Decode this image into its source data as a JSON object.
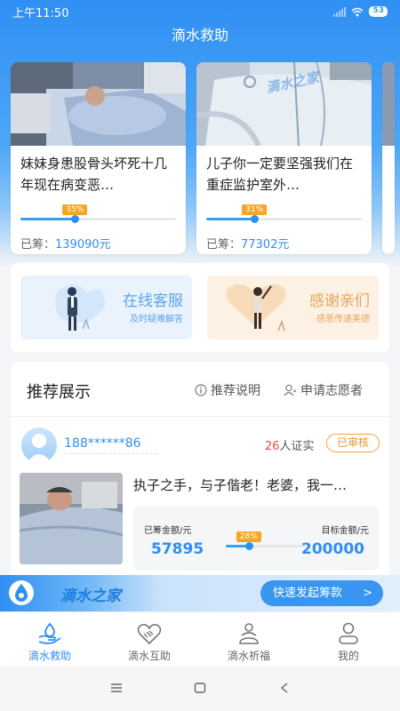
{
  "status_bar": {
    "time": "上午11:50",
    "battery": "53"
  },
  "app": {
    "title": "滴水救助"
  },
  "cases": [
    {
      "title": "妹妹身患股骨头坏死十几年现在病变恶…",
      "progress": 0.35,
      "progress_label": "35%",
      "raised_label": "已筹：",
      "raised_amount": "139090元"
    },
    {
      "title": "儿子你一定要坚强我们在重症监护室外…",
      "progress": 0.31,
      "progress_label": "31%",
      "raised_label": "已筹：",
      "raised_amount": "77302元",
      "watermark": "滴水之家"
    }
  ],
  "services": [
    {
      "title": "在线客服",
      "subtitle": "及时疑难解答"
    },
    {
      "title": "感谢亲们",
      "subtitle": "感恩传递美德"
    }
  ],
  "recommend": {
    "heading": "推荐展示",
    "explain_link": "推荐说明",
    "volunteer_link": "申请志愿者",
    "user": "188******86",
    "verify_count": "26",
    "verify_suffix": "人证实",
    "status_badge": "已审核",
    "title": "执子之手，与子偕老！老婆，我一…",
    "raised_label": "已筹金额/元",
    "raised_value": "57895",
    "target_label": "目标金额/元",
    "target_value": "200000",
    "progress": 0.28,
    "progress_label": "28%"
  },
  "banner": {
    "name": "滴水之家",
    "button": "快速发起筹款",
    "arrow": ">"
  },
  "tabs": [
    {
      "label": "滴水救助",
      "icon": "hand-drop-icon",
      "active": true
    },
    {
      "label": "滴水互助",
      "icon": "handshake-heart-icon",
      "active": false
    },
    {
      "label": "滴水祈福",
      "icon": "pray-icon",
      "active": false
    },
    {
      "label": "我的",
      "icon": "person-icon",
      "active": false
    }
  ],
  "colors": {
    "primary": "#2f8ff3",
    "accent": "#f6a623",
    "danger": "#e64b3c"
  }
}
